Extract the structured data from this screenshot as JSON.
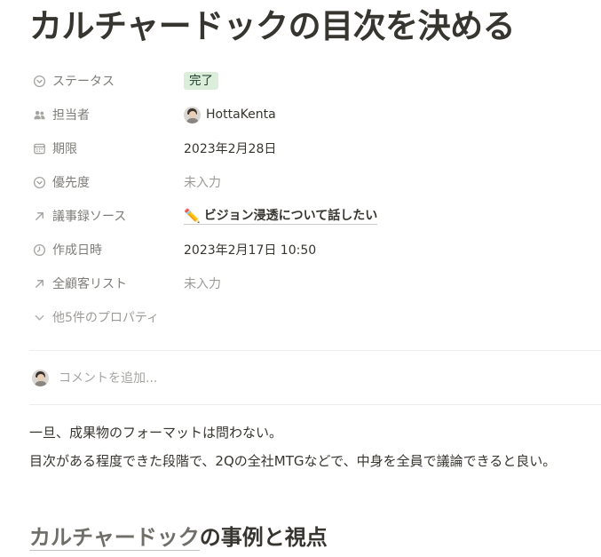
{
  "page": {
    "title": "カルチャードックの目次を決める"
  },
  "properties": [
    {
      "name": "ステータス",
      "icon": "status-icon",
      "value": "完了",
      "kind": "badge"
    },
    {
      "name": "担当者",
      "icon": "people-icon",
      "value": "HottaKenta",
      "kind": "person"
    },
    {
      "name": "期限",
      "icon": "calendar-icon",
      "value": "2023年2月28日",
      "kind": "text"
    },
    {
      "name": "優先度",
      "icon": "select-icon",
      "value": "未入力",
      "kind": "empty"
    },
    {
      "name": "議事録ソース",
      "icon": "relation-arrow-icon",
      "value": "ビジョン浸透について話したい",
      "emoji": "✏️",
      "kind": "relation"
    },
    {
      "name": "作成日時",
      "icon": "clock-icon",
      "value": "2023年2月17日 10:50",
      "kind": "text"
    },
    {
      "name": "全顧客リスト",
      "icon": "relation-arrow-icon",
      "value": "未入力",
      "kind": "empty"
    }
  ],
  "more_properties": "他5件のプロパティ",
  "comment": {
    "placeholder": "コメントを追加..."
  },
  "content": {
    "paragraphs": [
      "一旦、成果物のフォーマットは問わない。",
      "目次がある程度できた段階で、2Qの全社MTGなどで、中身を全員で議論できると良い。"
    ],
    "heading": {
      "link_text": "カルチャードック",
      "rest_text": "の事例と視点"
    }
  },
  "colors": {
    "text": "#37352f",
    "badge_bg": "#dbeddb",
    "badge_text": "#1c3829"
  }
}
